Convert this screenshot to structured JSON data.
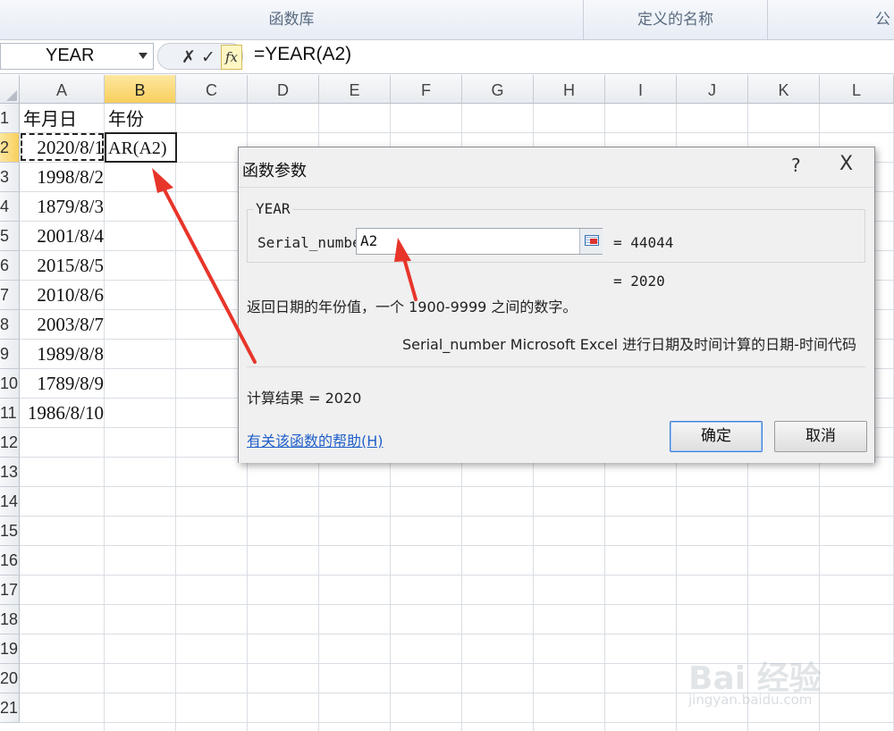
{
  "ribbon": {
    "groups": [
      "函数库",
      "定义的名称",
      "公"
    ]
  },
  "formula_bar": {
    "name_box": "YEAR",
    "cancel_symbol": "✗",
    "enter_symbol": "✓",
    "fx_symbol": "fx",
    "formula": "=YEAR(A2)"
  },
  "sheet": {
    "columns": [
      "A",
      "B",
      "C",
      "D",
      "E",
      "F",
      "G",
      "H",
      "I",
      "J",
      "K",
      "L"
    ],
    "selected_column": "B",
    "rows": [
      "1",
      "2",
      "3",
      "4",
      "5",
      "6",
      "7",
      "8",
      "9",
      "10",
      "11",
      "12",
      "13",
      "14",
      "15",
      "16",
      "17",
      "18",
      "19",
      "20",
      "21"
    ],
    "selected_row": "2",
    "header_a": "年月日",
    "header_b": "年份",
    "dates": [
      "2020/8/1",
      "1998/8/2",
      "1879/8/3",
      "2001/8/4",
      "2015/8/5",
      "2010/8/6",
      "2003/8/7",
      "1989/8/8",
      "1789/8/9",
      "1986/8/10"
    ],
    "editing_cell_text": "AR(A2)"
  },
  "dialog": {
    "title": "函数参数",
    "help_symbol": "?",
    "close_symbol": "X",
    "function_name": "YEAR",
    "arg_label": "Serial_number",
    "arg_value": "A2",
    "arg_result": "= 44044",
    "result_preview": "= 2020",
    "description": "返回日期的年份值，一个 1900-9999 之间的数字。",
    "arg_description": "Serial_number  Microsoft Excel 进行日期及时间计算的日期-时间代码",
    "calc_result": "计算结果 =  2020",
    "help_link": "有关该函数的帮助(H)",
    "ok_label": "确定",
    "cancel_label": "取消"
  },
  "watermark": {
    "brand": "Bai 经验",
    "url": "jingyan.baidu.com"
  },
  "colors": {
    "arrow": "#e8352a",
    "selected_header": "#f8cf5d",
    "link": "#1f5fc9"
  }
}
